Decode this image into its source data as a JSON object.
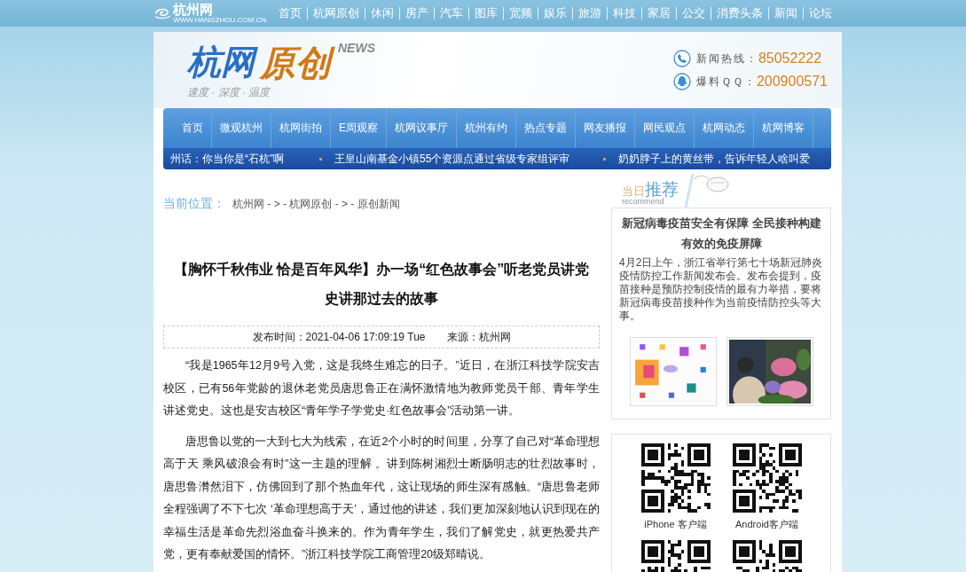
{
  "top_bar": {
    "logo": {
      "name": "杭州网",
      "url": "WWW.HANGZHOU.COM.CN"
    },
    "links": [
      "首页",
      "杭网原创",
      "休闲",
      "房产",
      "汽车",
      "图库",
      "宽频",
      "娱乐",
      "旅游",
      "科技",
      "家居",
      "公交",
      "消费头条",
      "新闻",
      "论坛"
    ]
  },
  "header": {
    "logo": {
      "title_1": "杭网",
      "title_2": "原创",
      "badge": "NEWS",
      "slogan": "速度 · 深度 · 温度"
    },
    "contacts": [
      {
        "kind": "phone",
        "label": "新闻热线：",
        "value": "85052222"
      },
      {
        "kind": "qq",
        "label": "爆料ＱＱ：",
        "value": "200900571"
      }
    ]
  },
  "nav": [
    "首页",
    "微观杭州",
    "杭网街拍",
    "E周观察",
    "杭网议事厅",
    "杭州有约",
    "热点专题",
    "网友播报",
    "网民观点",
    "杭网动态",
    "杭网博客"
  ],
  "ticker": [
    "州话：你当你是“石杭”啊",
    "王皇山南基金小镇55个资源点通过省级专家组评审",
    "奶奶脖子上的黄丝带，告诉年轻人啥叫爱"
  ],
  "breadcrumb": {
    "label": "当前位置：",
    "path": "杭州网 - > - 杭网原创 - > - 原创新闻"
  },
  "article": {
    "title": "【胸怀千秋伟业 恰是百年风华】办一场“红色故事会”听老党员讲党史讲那过去的故事",
    "published": "发布时间：2021-04-06 17:09:19 Tue",
    "source": "来源：杭州网",
    "paragraphs": [
      "“我是1965年12月9号入党，这是我终生难忘的日子。”近日，在浙江科技学院安吉校区，已有56年党龄的退休老党员唐思鲁正在满怀激情地为教师党员干部、青年学生讲述党史。这也是安吉校区“青年学子学党史·红色故事会”活动第一讲。",
      "唐思鲁以党的一大到七大为线索，在近2个小时的时间里，分享了自己对“革命理想高于天 乘风破浪会有时”这一主题的理解 。讲到陈树湘烈士断肠明志的壮烈故事时，唐思鲁潸然泪下，仿佛回到了那个热血年代，这让现场的师生深有感触。“唐思鲁老师全程强调了不下七次 ‘革命理想高于天’，通过他的讲述，我们更加深刻地认识到现在的幸福生活是革命先烈浴血奋斗换来的。作为青年学生，我们了解党史，就更热爱共产党，更有奉献爱国的情怀。”浙江科技学院工商管理20级郑晴说。"
    ]
  },
  "sidebar": {
    "recommend": {
      "heading_1": "当日",
      "heading_2": "推荐",
      "subtitle": "recommend",
      "title": "新冠病毒疫苗安全有保障 全民接种构建有效的免疫屏障",
      "summary": "4月2日上午，浙江省举行第七十场新冠肺炎疫情防控工作新闻发布会。发布会提到，疫苗接种是预防控制疫情的最有力举措，要将新冠病毒疫苗接种作为当前疫情防控头等大事。"
    },
    "apps": [
      {
        "kind": "qr-code",
        "label": "iPhone 客户端"
      },
      {
        "kind": "qr-code",
        "label": "Android客户端"
      },
      {
        "kind": "qr-code"
      },
      {
        "kind": "qr-code"
      }
    ]
  }
}
